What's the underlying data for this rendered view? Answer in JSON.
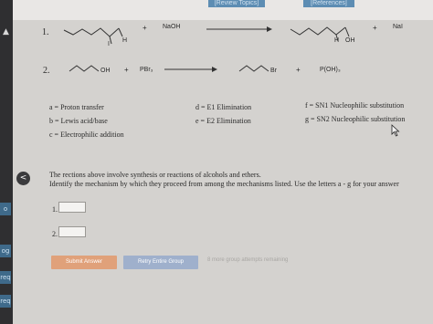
{
  "header": {
    "review_topics": "[Review Topics]",
    "references": "[References]"
  },
  "reactions": [
    {
      "number": "1.",
      "reagent": "NaOH",
      "reactant_labels": [
        "I",
        "H"
      ],
      "product_labels": [
        "H",
        "OH"
      ],
      "byproduct": "NaI"
    },
    {
      "number": "2.",
      "reactant_label": "OH",
      "reagent": "PBr₃",
      "product_label": "Br",
      "byproduct": "P(OH)₃"
    }
  ],
  "legend": {
    "a": "a = Proton transfer",
    "b": "b = Lewis acid/base",
    "c": "c = Electrophilic addition",
    "d": "d = E1 Elimination",
    "e": "e = E2 Elimination",
    "f": "f = SN1 Nucleophilic substitution",
    "g": "g = SN2 Nucleophilic substitution"
  },
  "question": {
    "line1": "The rections above involve synthesis or reactions of alcohols and ethers.",
    "line2": "Identify the mechanism by which they proceed from among the mechanisms listed. Use the letters a - g for your answer"
  },
  "answers": [
    {
      "label": "1.",
      "value": ""
    },
    {
      "label": "2.",
      "value": ""
    }
  ],
  "buttons": {
    "submit": "Submit Answer",
    "retry": "Retry Entire Group"
  },
  "attempts_note": "8 more group attempts remaining",
  "nav": {
    "prev_icon": "<"
  },
  "sidebar": {
    "tabs": [
      "o",
      "og",
      "req",
      "req"
    ]
  },
  "colors": {
    "submit": "#e0a17a",
    "retry": "#9fb0cc",
    "top_tab": "#5d8db3"
  },
  "icons": [
    "chevron-up-icon",
    "prev-arrow-icon",
    "mouse-pointer-icon",
    "reaction-arrow-icon"
  ]
}
